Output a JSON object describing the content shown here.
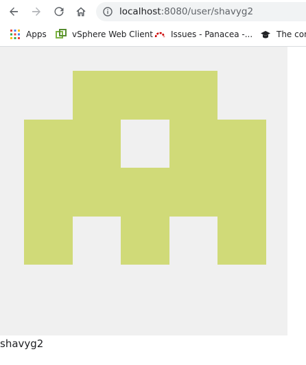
{
  "browser": {
    "url_host": "localhost",
    "url_path": ":8080/user/shavyg2",
    "bookmarks": [
      {
        "label": "Apps",
        "icon": "apps-grid-icon"
      },
      {
        "label": "vSphere Web Client",
        "icon": "vsphere-icon"
      },
      {
        "label": "Issues - Panacea -...",
        "icon": "redhat-icon"
      },
      {
        "label": "The com",
        "icon": "graduation-cap-icon"
      }
    ]
  },
  "avatar": {
    "background": "#f0f0f0",
    "color": "#d0da78",
    "grid_size": 5,
    "pattern": [
      [
        0,
        1,
        1,
        1,
        0
      ],
      [
        1,
        1,
        0,
        1,
        1
      ],
      [
        1,
        1,
        1,
        1,
        1
      ],
      [
        1,
        0,
        1,
        0,
        1
      ],
      [
        0,
        0,
        0,
        0,
        0
      ]
    ]
  },
  "username": "shavyg2"
}
